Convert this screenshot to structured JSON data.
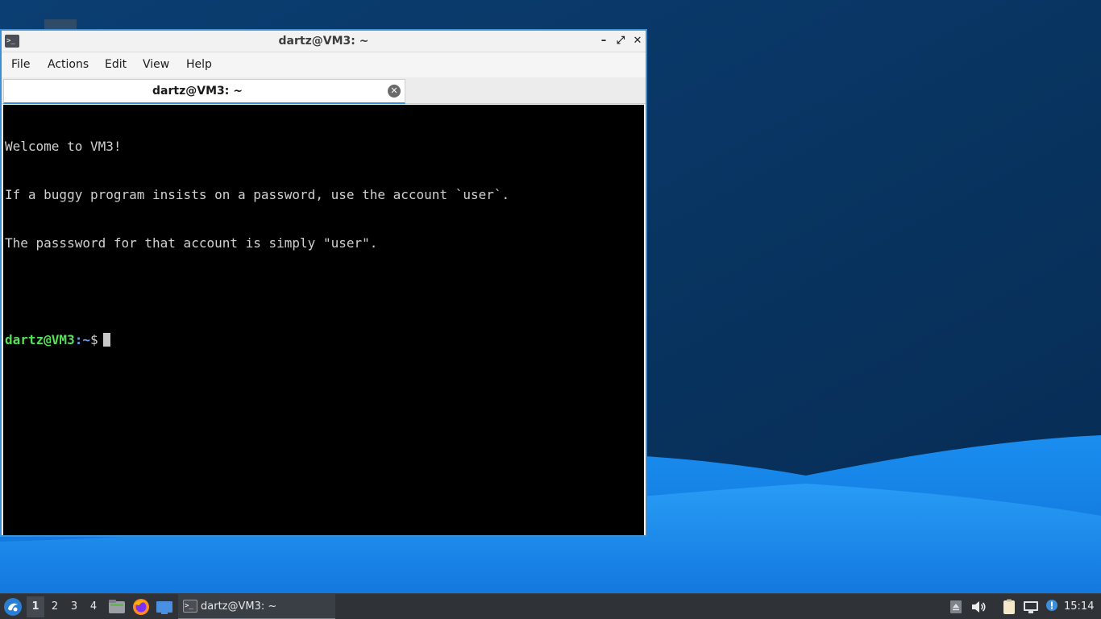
{
  "window": {
    "title": "dartz@VM3: ~",
    "icon": "terminal-icon",
    "controls": {
      "minimize": "–",
      "maximize": "⤢",
      "close": "✕"
    }
  },
  "menubar": {
    "items": [
      "File",
      "Actions",
      "Edit",
      "View",
      "Help"
    ]
  },
  "tabs": [
    {
      "label": "dartz@VM3: ~",
      "close_icon": "close-icon"
    }
  ],
  "terminal": {
    "lines": [
      "Welcome to VM3!",
      "If a buggy program insists on a password, use the account `user`.",
      "The passsword for that account is simply \"user\".",
      ""
    ],
    "prompt": {
      "user_host": "dartz@VM3",
      "separator": ":",
      "path": "~",
      "symbol": "$"
    }
  },
  "taskbar": {
    "start_icon": "lxqt-start-icon",
    "workspaces": [
      "1",
      "2",
      "3",
      "4"
    ],
    "active_workspace": "1",
    "quick_launch": [
      "file-manager-icon",
      "firefox-icon",
      "show-desktop-icon"
    ],
    "tasks": [
      {
        "label": "dartz@VM3: ~",
        "icon": "terminal-icon"
      }
    ],
    "tray": [
      "eject-icon",
      "volume-icon",
      "clipboard-icon",
      "network-icon",
      "update-notifier-icon"
    ],
    "clock": "15:14"
  },
  "colors": {
    "accent": "#3d8fd8",
    "terminal_bg": "#000000",
    "prompt_user": "#55e055",
    "prompt_path": "#6e9ef0",
    "taskbar_bg": "#2f3338"
  }
}
